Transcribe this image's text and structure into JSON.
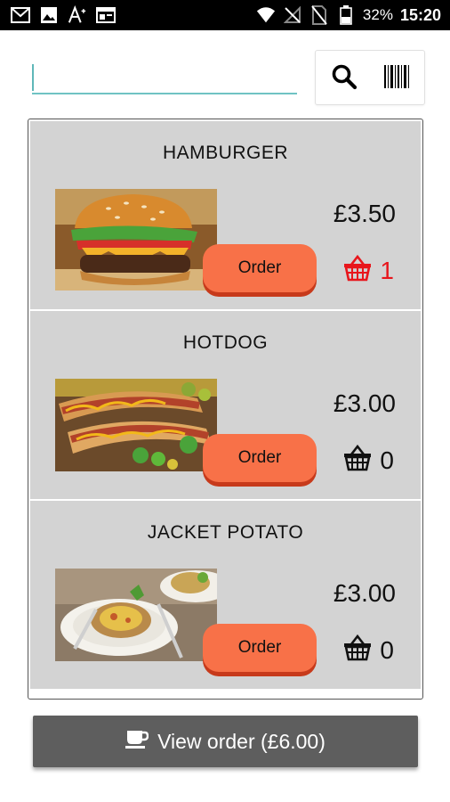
{
  "status_bar": {
    "left_icons": [
      "gmail-icon",
      "image-icon",
      "text-size-icon",
      "calendar-icon"
    ],
    "battery": "32%",
    "time": "15:20"
  },
  "search": {
    "placeholder": "",
    "value": ""
  },
  "items": [
    {
      "name": "HAMBURGER",
      "price": "£3.50",
      "order_label": "Order",
      "basket_count": "1",
      "basket_color": "#e8161c"
    },
    {
      "name": "HOTDOG",
      "price": "£3.00",
      "order_label": "Order",
      "basket_count": "0",
      "basket_color": "#111111"
    },
    {
      "name": "JACKET POTATO",
      "price": "£3.00",
      "order_label": "Order",
      "basket_count": "0",
      "basket_color": "#111111"
    }
  ],
  "view_order": {
    "label": "View order (£6.00)",
    "icon": "cup-icon"
  },
  "colors": {
    "accent": "#f87148",
    "search_underline": "#6fc3c4",
    "item_background": "#d3d3d3",
    "view_order_bg": "#5e5e5e"
  }
}
